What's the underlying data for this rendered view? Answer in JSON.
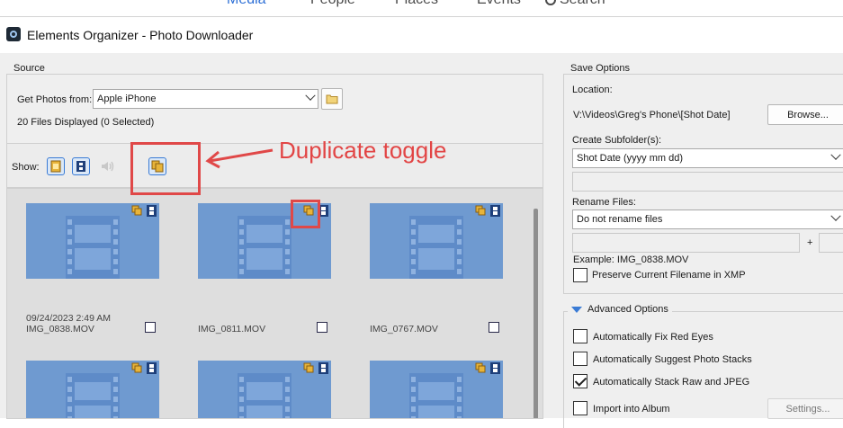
{
  "top_nav": {
    "tabs": [
      {
        "label": "Media"
      },
      {
        "label": "People"
      },
      {
        "label": "Places"
      },
      {
        "label": "Events"
      },
      {
        "label": "Search"
      }
    ]
  },
  "window": {
    "title": "Elements Organizer - Photo Downloader"
  },
  "source": {
    "group_label": "Source",
    "get_photos_label": "Get Photos from:",
    "device_value": "Apple iPhone",
    "files_status": "20 Files Displayed (0 Selected)",
    "show_label": "Show:"
  },
  "annotation": {
    "text": "Duplicate toggle",
    "color": "#e24545"
  },
  "thumbnails": [
    {
      "date": "09/24/2023 2:49 AM",
      "filename": "IMG_0838.MOV"
    },
    {
      "date": "",
      "filename": "IMG_0811.MOV"
    },
    {
      "date": "",
      "filename": "IMG_0767.MOV"
    }
  ],
  "save_options": {
    "group_label": "Save Options",
    "location_label": "Location:",
    "location_path": "V:\\Videos\\Greg's Phone\\[Shot Date]",
    "browse_label": "Browse...",
    "subfolder_label": "Create Subfolder(s):",
    "subfolder_value": "Shot Date (yyyy mm dd)",
    "rename_label": "Rename Files:",
    "rename_value": "Do not rename files",
    "plus": "+",
    "example": "Example:  IMG_0838.MOV",
    "preserve_label": "Preserve Current Filename in XMP"
  },
  "advanced": {
    "header": "Advanced Options",
    "options": [
      {
        "label": "Automatically Fix Red Eyes",
        "checked": false
      },
      {
        "label": "Automatically Suggest Photo Stacks",
        "checked": false
      },
      {
        "label": "Automatically Stack Raw and JPEG",
        "checked": true
      },
      {
        "label": "Import into Album",
        "checked": false
      }
    ],
    "settings_label": "Settings..."
  },
  "colors": {
    "accent": "#2d6fd6",
    "thumbnail": "#6f9ad0",
    "annotation": "#e04848"
  }
}
